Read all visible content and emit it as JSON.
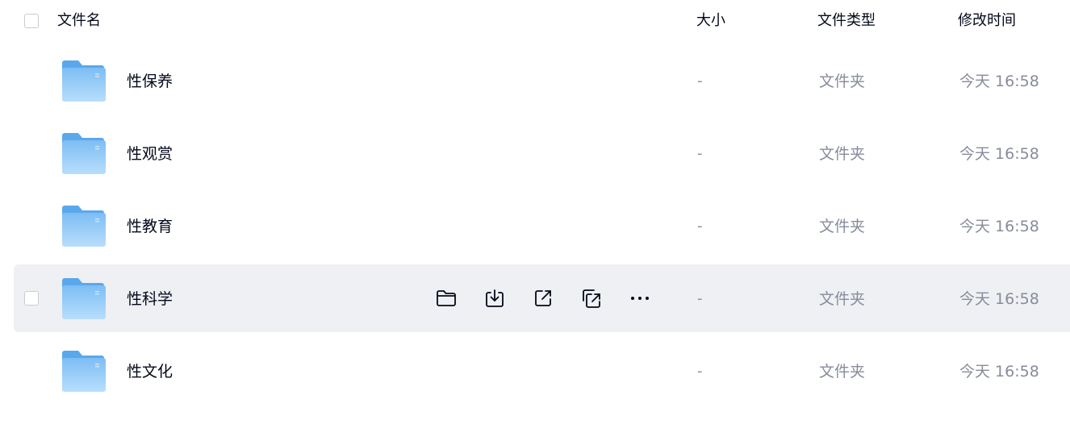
{
  "header": {
    "name_label": "文件名",
    "size_label": "大小",
    "type_label": "文件类型",
    "time_label": "修改时间"
  },
  "rows": [
    {
      "name": "性保养",
      "size": "-",
      "type": "文件夹",
      "modified": "今天 16:58"
    },
    {
      "name": "性观赏",
      "size": "-",
      "type": "文件夹",
      "modified": "今天 16:58"
    },
    {
      "name": "性教育",
      "size": "-",
      "type": "文件夹",
      "modified": "今天 16:58"
    },
    {
      "name": "性科学",
      "size": "-",
      "type": "文件夹",
      "modified": "今天 16:58"
    },
    {
      "name": "性文化",
      "size": "-",
      "type": "文件夹",
      "modified": "今天 16:58"
    }
  ],
  "hover_row_actions": [
    "open-folder-icon",
    "download-icon",
    "share-icon",
    "move-copy-icon",
    "more-icon"
  ],
  "colors": {
    "folder": "#8cc8f5",
    "hover_bg": "#eff0f3",
    "secondary_text": "#878c9c"
  }
}
